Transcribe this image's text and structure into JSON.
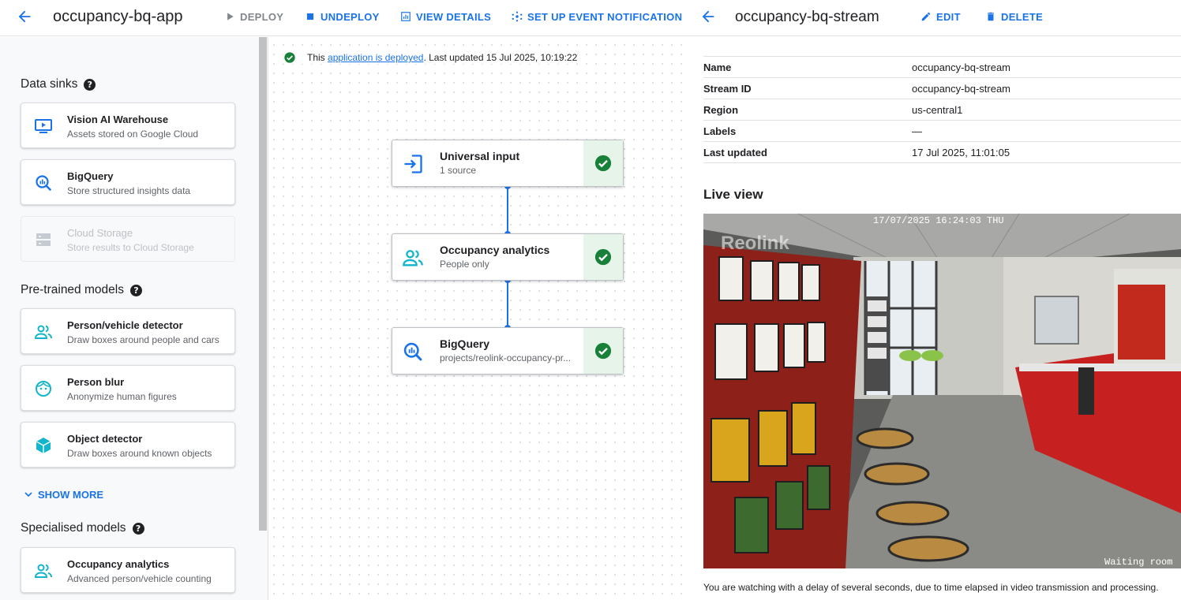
{
  "app_bar": {
    "title": "occupancy-bq-app",
    "actions": {
      "deploy": "DEPLOY",
      "undeploy": "UNDEPLOY",
      "view_details": "VIEW DETAILS",
      "event_notification": "SET UP EVENT NOTIFICATION"
    }
  },
  "stream_bar": {
    "title": "occupancy-bq-stream",
    "edit": "EDIT",
    "delete": "DELETE"
  },
  "sidebar": {
    "data_sinks": {
      "title": "Data sinks",
      "items": [
        {
          "name": "Vision AI Warehouse",
          "desc": "Assets stored on Google Cloud",
          "icon": "monitor-play-icon",
          "enabled": true
        },
        {
          "name": "BigQuery",
          "desc": "Store structured insights data",
          "icon": "bigquery-icon",
          "enabled": true
        },
        {
          "name": "Cloud Storage",
          "desc": "Store results to Cloud Storage",
          "icon": "storage-icon",
          "enabled": false
        }
      ]
    },
    "pretrained": {
      "title": "Pre-trained models",
      "items": [
        {
          "name": "Person/vehicle detector",
          "desc": "Draw boxes around people and cars",
          "icon": "people-icon"
        },
        {
          "name": "Person blur",
          "desc": "Anonymize human figures",
          "icon": "face-icon"
        },
        {
          "name": "Object detector",
          "desc": "Draw boxes around known objects",
          "icon": "cube-icon"
        }
      ]
    },
    "show_more": "SHOW MORE",
    "specialised": {
      "title": "Specialised models",
      "items": [
        {
          "name": "Occupancy analytics",
          "desc": "Advanced person/vehicle counting",
          "icon": "people-icon"
        }
      ]
    }
  },
  "status": {
    "prefix": "This ",
    "link": "application is deployed",
    "suffix": ". Last updated 15 Jul 2025, 10:19:22"
  },
  "graph": {
    "nodes": [
      {
        "name": "Universal input",
        "desc": "1 source",
        "icon": "input-icon",
        "state": "ok"
      },
      {
        "name": "Occupancy analytics",
        "desc": "People only",
        "icon": "people-icon",
        "state": "ok"
      },
      {
        "name": "BigQuery",
        "desc": "projects/reolink-occupancy-pr...",
        "icon": "bigquery-icon",
        "state": "ok"
      }
    ]
  },
  "stream": {
    "properties": [
      {
        "key": "Name",
        "value": "occupancy-bq-stream"
      },
      {
        "key": "Stream ID",
        "value": "occupancy-bq-stream"
      },
      {
        "key": "Region",
        "value": "us-central1"
      },
      {
        "key": "Labels",
        "value": "—"
      },
      {
        "key": "Last updated",
        "value": "17 Jul 2025, 11:01:05"
      }
    ],
    "live_view_title": "Live view",
    "overlay_timestamp": "17/07/2025 16:24:03 THU",
    "overlay_watermark": "Reolink",
    "overlay_camera": "Waiting room",
    "caption": "You are watching with a delay of several seconds, due to time elapsed in video transmission and processing."
  },
  "colors": {
    "accent": "#1a73e8",
    "success": "#188038",
    "success_bg": "#e6f4ea",
    "teal_icon": "#12b5cb"
  }
}
